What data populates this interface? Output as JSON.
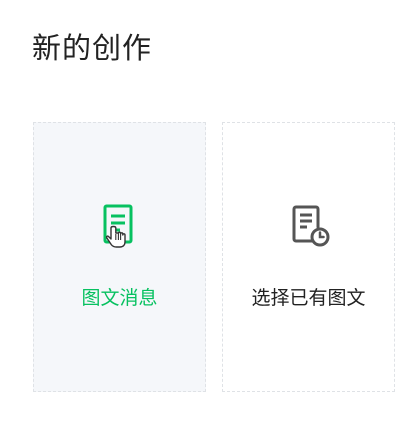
{
  "page": {
    "title": "新的创作"
  },
  "cards": [
    {
      "label": "图文消息",
      "icon": "article-document-icon",
      "state": "hover"
    },
    {
      "label": "选择已有图文",
      "icon": "document-clock-icon",
      "state": "default"
    }
  ],
  "cursor": {
    "icon": "hand-pointer-icon"
  },
  "colors": {
    "accent": "#07c160",
    "text": "#222222",
    "icon_gray": "#555555",
    "card_hover_bg": "#f5f7fa",
    "card_border": "#dfe2e6"
  }
}
